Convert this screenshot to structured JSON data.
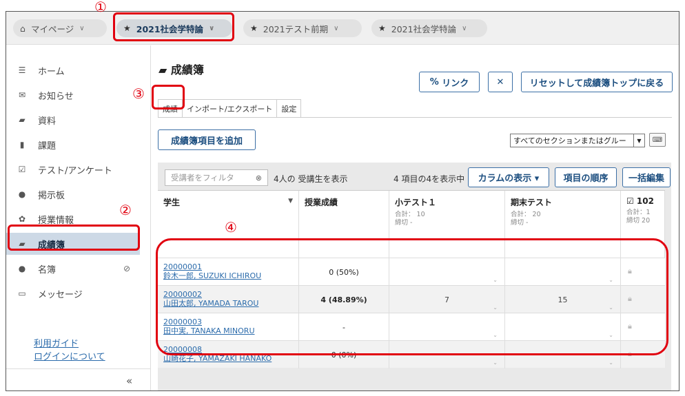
{
  "sites": [
    {
      "label": "マイページ",
      "icon": "home-icon"
    },
    {
      "label": "2021社会学特論",
      "icon": "star-icon",
      "active": true
    },
    {
      "label": "2021テスト前期",
      "icon": "star-icon"
    },
    {
      "label": "2021社会学特論",
      "icon": "star-icon"
    }
  ],
  "sidebar": {
    "items": [
      {
        "label": "ホーム",
        "icon": "list-icon",
        "glyph": "☰"
      },
      {
        "label": "お知らせ",
        "icon": "megaphone-icon",
        "glyph": "✉"
      },
      {
        "label": "資料",
        "icon": "folder-icon",
        "glyph": "▰"
      },
      {
        "label": "課題",
        "icon": "file-icon",
        "glyph": "▮"
      },
      {
        "label": "テスト/アンケート",
        "icon": "checkbox-icon",
        "glyph": "☑"
      },
      {
        "label": "掲示板",
        "icon": "chat-icon",
        "glyph": "●"
      },
      {
        "label": "授業情報",
        "icon": "gear-icon",
        "glyph": "✿"
      },
      {
        "label": "成績簿",
        "icon": "book-icon",
        "glyph": "▰",
        "active": true
      },
      {
        "label": "名簿",
        "icon": "users-icon",
        "glyph": "●"
      },
      {
        "label": "メッセージ",
        "icon": "inbox-icon",
        "glyph": "▭"
      }
    ],
    "links": [
      "利用ガイド",
      "ログインについて"
    ],
    "collapse_glyph": "«"
  },
  "main": {
    "title": "成績簿",
    "link_button": "リンク",
    "expand_glyph": "✕",
    "reset_button": "リセットして成績簿トップに戻る",
    "tabs": [
      "成績",
      "インポート/エクスポート",
      "設定"
    ],
    "add_item_button": "成績簿項目を追加",
    "section_select": "すべてのセクションまたはグルー",
    "filter_placeholder": "受講者をフィルタ",
    "students_shown": "4人の 受講生を表示",
    "items_shown": "4 項目の4を表示中",
    "columns_button": "カラムの表示 ▾",
    "order_button": "項目の順序",
    "bulk_edit_button": "一括編集"
  },
  "grid": {
    "headers": [
      {
        "title": "学生"
      },
      {
        "title": "授業成績"
      },
      {
        "title": "小テスト１",
        "total": "合計： 10",
        "due": "締切 -"
      },
      {
        "title": "期末テスト",
        "total": "合計： 20",
        "due": "締切 -"
      },
      {
        "title": "☑ 102",
        "total": "合計：1",
        "due": "締切 20"
      }
    ],
    "rows": [
      {
        "id": "20000001",
        "name": "鈴木一郎, SUZUKI ICHIROU",
        "grade": "0 (50%)",
        "bold": false,
        "quiz": "",
        "final": ""
      },
      {
        "id": "20000002",
        "name": "山田太郎, YAMADA TAROU",
        "grade": "4 (48.89%)",
        "bold": true,
        "quiz": "7",
        "final": "15"
      },
      {
        "id": "20000003",
        "name": "田中実, TANAKA MINORU",
        "grade": "-",
        "bold": false,
        "quiz": "",
        "final": ""
      },
      {
        "id": "20000008",
        "name": "山崎花子, YAMAZAKI HANAKO",
        "grade": "0 (0%)",
        "bold": false,
        "quiz": "",
        "final": ""
      }
    ]
  },
  "annotations": [
    "①",
    "②",
    "③",
    "④"
  ]
}
